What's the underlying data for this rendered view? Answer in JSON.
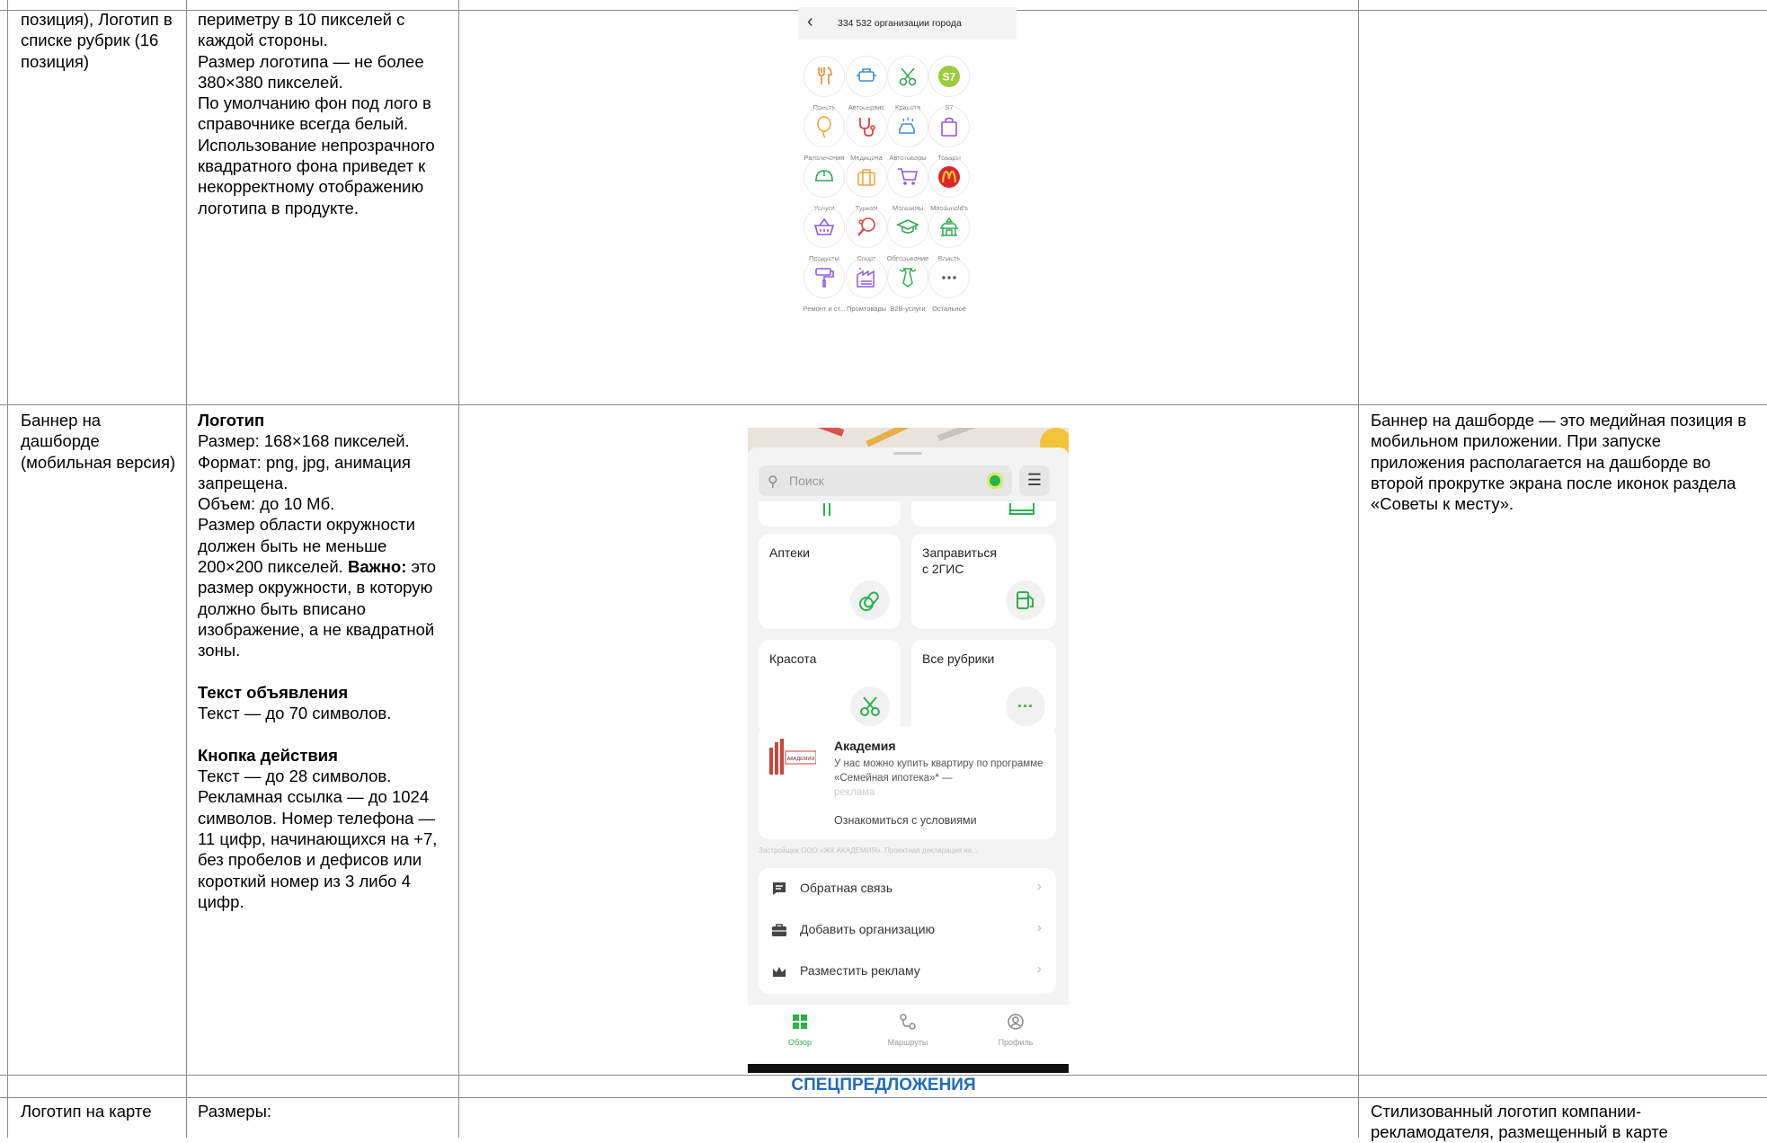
{
  "row1": {
    "col1": "позиция), Логотип в списке рубрик (16 позиция)",
    "col2": "периметру в 10 пикселей с каждой стороны.\nРазмер логотипа — не более 380×380 пикселей.\nПо умолчанию фон под лого в справочнике всегда белый.\nИспользование непрозрачного квадратного фона приведет к некорректному отображению логотипа в продукте."
  },
  "categories_screen": {
    "back_icon": "chevron-left-icon",
    "title": "334 532 организации города",
    "items": [
      {
        "label": "Поесть",
        "icon": "fork-knife-icon",
        "color": "#e9892f"
      },
      {
        "label": "Автосервис",
        "icon": "car-engine-icon",
        "color": "#3a8fd6"
      },
      {
        "label": "Красота",
        "icon": "scissors-icon",
        "color": "#34a853"
      },
      {
        "label": "S7",
        "icon": "s7-logo",
        "color": "#9ccb3b"
      },
      {
        "label": "Развлечения",
        "icon": "balloon-icon",
        "color": "#f0a43a"
      },
      {
        "label": "Медицина",
        "icon": "stethoscope-icon",
        "color": "#e0413f"
      },
      {
        "label": "Автотовары",
        "icon": "car-wash-icon",
        "color": "#3a8fd6"
      },
      {
        "label": "Товары",
        "icon": "bag-icon",
        "color": "#8e5ad8"
      },
      {
        "label": "Услуги",
        "icon": "helmet-icon",
        "color": "#34a853"
      },
      {
        "label": "Туризм",
        "icon": "suitcase-icon",
        "color": "#f0a43a"
      },
      {
        "label": "Магазины",
        "icon": "cart-icon",
        "color": "#8e5ad8"
      },
      {
        "label": "Macdonald's",
        "icon": "mcdonalds-logo",
        "color": "#d9262c"
      },
      {
        "label": "Продукты",
        "icon": "basket-icon",
        "color": "#8e5ad8"
      },
      {
        "label": "Спорт",
        "icon": "racket-icon",
        "color": "#e0413f"
      },
      {
        "label": "Образование",
        "icon": "graduation-cap-icon",
        "color": "#34a853"
      },
      {
        "label": "Власть",
        "icon": "government-icon",
        "color": "#34a853"
      },
      {
        "label": "Ремонт и ст...",
        "icon": "paint-roller-icon",
        "color": "#8e5ad8"
      },
      {
        "label": "Промтовары",
        "icon": "factory-icon",
        "color": "#8e5ad8"
      },
      {
        "label": "B2B-услуги",
        "icon": "tie-icon",
        "color": "#34a853"
      },
      {
        "label": "Остальное",
        "icon": "more-dots-icon",
        "color": "#555555"
      }
    ]
  },
  "row2": {
    "col1": "Баннер на дашборде (мобильная версия)",
    "logo_heading": "Логотип",
    "logo_text_1": "Размер: 168×168 пикселей.\nФормат: png, jpg, анимация запрещена.\nОбъем: до 10 Мб.\nРазмер области окружности должен быть не меньше 200×200 пикселей. ",
    "logo_important": "Важно:",
    "logo_text_2": " это размер окружности, в которую должно быть вписано изображение, а не квадратной зоны.",
    "adtext_heading": "Текст объявления",
    "adtext_text": "Текст — до 70 символов.",
    "button_heading": "Кнопка действия",
    "button_text": "Текст — до 28 символов.\nРекламная ссылка — до 1024 символов. Номер телефона — 11 цифр, начинающихся на +7, без пробелов и дефисов или короткий номер из 3 либо 4 цифр.",
    "col4": "Баннер на дашборде — это медийная позиция в мобильном приложении. При запуске приложения располагается на дашборде во второй прокрутке экрана после иконок раздела «Советы к месту»."
  },
  "dashboard_screen": {
    "search_placeholder": "Поиск",
    "menu_icon": "hamburger-icon",
    "tiles": [
      {
        "label": "Аптеки",
        "icon": "pills-icon"
      },
      {
        "label": "Заправиться\nс 2ГИС",
        "icon": "fuel-pump-icon"
      },
      {
        "label": "Красота",
        "icon": "scissors-icon"
      },
      {
        "label": "Все рубрики",
        "icon": "more-dots-icon"
      }
    ],
    "ad": {
      "logo_text": "АКАДЕМИЯ",
      "name": "Академия",
      "text": "У нас можно купить квартиру по программе «Семейная ипотека»* —",
      "marker": "реклама",
      "link": "Ознакомиться с условиями",
      "legal": "Застройщик ООО «ЖК АКАДЕМИЯ». Проектная декларация на..."
    },
    "menu_items": [
      {
        "label": "Обратная связь",
        "icon": "chat-icon"
      },
      {
        "label": "Добавить организацию",
        "icon": "briefcase-icon"
      },
      {
        "label": "Разместить рекламу",
        "icon": "crown-icon"
      }
    ],
    "tabs": [
      {
        "label": "Обзор",
        "icon": "grid-icon",
        "active": true
      },
      {
        "label": "Маршруты",
        "icon": "route-icon",
        "active": false
      },
      {
        "label": "Профиль",
        "icon": "profile-icon",
        "active": false
      }
    ],
    "accent_color": "#2bb24c"
  },
  "section_title": "СПЕЦПРЕДЛОЖЕНИЯ",
  "row3": {
    "col1": "Логотип на карте",
    "col2": "Размеры:",
    "col4": "Стилизованный логотип компании-рекламодателя, размещенный в карте"
  }
}
